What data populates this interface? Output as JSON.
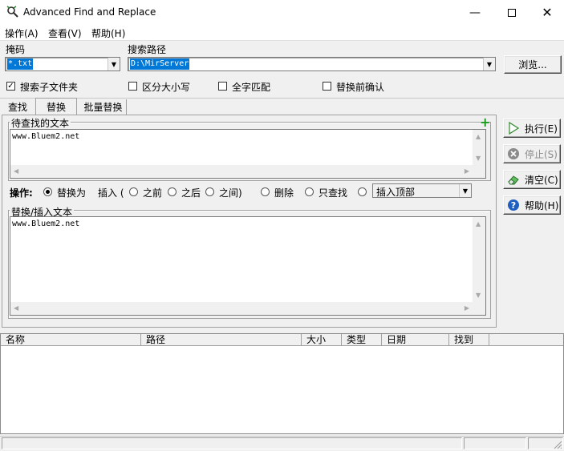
{
  "window": {
    "title": "Advanced Find and Replace"
  },
  "menu": [
    "操作(A)",
    "查看(V)",
    "帮助(H)"
  ],
  "mask": {
    "label": "掩码",
    "value": "*.txt"
  },
  "search_path": {
    "label": "搜索路径",
    "value": "D:\\MirServer"
  },
  "browse_label": "浏览...",
  "options": {
    "subfolders": "搜索子文件夹",
    "case": "区分大小写",
    "whole_word": "全字匹配",
    "confirm": "替换前确认"
  },
  "tabs": [
    "查找",
    "替换",
    "批量替换"
  ],
  "find_section": {
    "label": "待查找的文本",
    "value": "www.Bluem2.net"
  },
  "operation": {
    "label": "操作:",
    "replace_with": "替换为",
    "insert": "插入 (",
    "before": "之前",
    "after": "之后",
    "between": "之间)",
    "delete": "删除",
    "find_only": "只查找",
    "insert_position": "插入顶部"
  },
  "replace_section": {
    "label": "替换/插入文本",
    "value": "www.Bluem2.net"
  },
  "buttons": {
    "execute": "执行(E)",
    "stop": "停止(S)",
    "clear": "清空(C)",
    "help": "帮助(H)"
  },
  "results_columns": [
    "名称",
    "路径",
    "大小",
    "类型",
    "日期",
    "找到"
  ],
  "colors": {
    "accent": "#0078d7",
    "selection": "#0078d7",
    "plus": "#1a9a1a"
  }
}
